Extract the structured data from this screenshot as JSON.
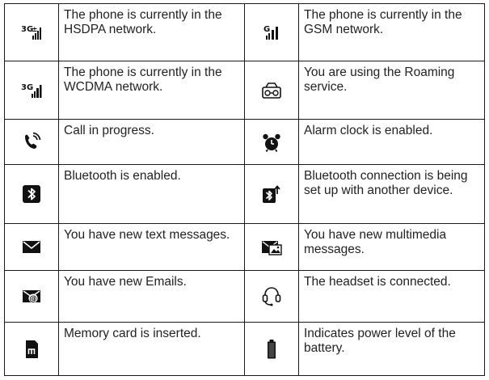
{
  "rows": [
    {
      "left": {
        "icon": "hsdpa-signal-icon",
        "text": "The phone is currently in the HSDPA network."
      },
      "right": {
        "icon": "gsm-signal-icon",
        "text": "The phone is currently in the GSM network."
      }
    },
    {
      "left": {
        "icon": "wcdma-signal-icon",
        "text": "The phone is currently in the WCDMA network."
      },
      "right": {
        "icon": "roaming-icon",
        "text": "You are using the Roaming service."
      }
    },
    {
      "left": {
        "icon": "call-in-progress-icon",
        "text": "Call in progress."
      },
      "right": {
        "icon": "alarm-clock-icon",
        "text": "Alarm clock is enabled."
      }
    },
    {
      "left": {
        "icon": "bluetooth-enabled-icon",
        "text": "Bluetooth is enabled."
      },
      "right": {
        "icon": "bluetooth-connecting-icon",
        "text": "Bluetooth connection is being set up with another device."
      }
    },
    {
      "left": {
        "icon": "text-message-icon",
        "text": "You have new text messages."
      },
      "right": {
        "icon": "multimedia-message-icon",
        "text": "You have new multimedia messages."
      }
    },
    {
      "left": {
        "icon": "email-icon",
        "text": "You have new Emails."
      },
      "right": {
        "icon": "headset-icon",
        "text": "The headset is connected."
      }
    },
    {
      "left": {
        "icon": "memory-card-icon",
        "text": "Memory card is inserted."
      },
      "right": {
        "icon": "battery-icon",
        "text": "Indicates power level of the battery."
      }
    }
  ]
}
